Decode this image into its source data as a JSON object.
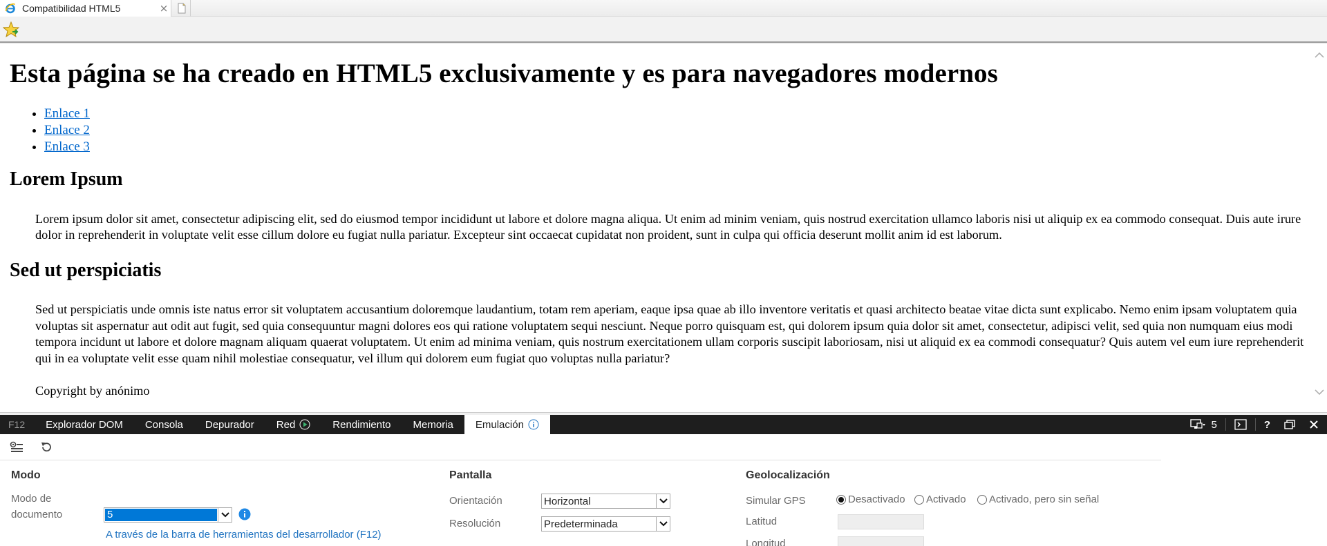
{
  "browser": {
    "tab_title": "Compatibilidad HTML5",
    "tab_close": "×"
  },
  "page": {
    "heading": "Esta página se ha creado en HTML5 exclusivamente y es para navegadores modernos",
    "links": [
      "Enlace 1",
      "Enlace 2",
      "Enlace 3"
    ],
    "section1_title": "Lorem Ipsum",
    "section1_text": "Lorem ipsum dolor sit amet, consectetur adipiscing elit, sed do eiusmod tempor incididunt ut labore et dolore magna aliqua. Ut enim ad minim veniam, quis nostrud exercitation ullamco laboris nisi ut aliquip ex ea commodo consequat. Duis aute irure dolor in reprehenderit in voluptate velit esse cillum dolore eu fugiat nulla pariatur. Excepteur sint occaecat cupidatat non proident, sunt in culpa qui officia deserunt mollit anim id est laborum.",
    "section2_title": "Sed ut perspiciatis",
    "section2_text": "Sed ut perspiciatis unde omnis iste natus error sit voluptatem accusantium doloremque laudantium, totam rem aperiam, eaque ipsa quae ab illo inventore veritatis et quasi architecto beatae vitae dicta sunt explicabo. Nemo enim ipsam voluptatem quia voluptas sit aspernatur aut odit aut fugit, sed quia consequuntur magni dolores eos qui ratione voluptatem sequi nesciunt. Neque porro quisquam est, qui dolorem ipsum quia dolor sit amet, consectetur, adipisci velit, sed quia non numquam eius modi tempora incidunt ut labore et dolore magnam aliquam quaerat voluptatem. Ut enim ad minima veniam, quis nostrum exercitationem ullam corporis suscipit laboriosam, nisi ut aliquid ex ea commodi consequatur? Quis autem vel eum iure reprehenderit qui in ea voluptate velit esse quam nihil molestiae consequatur, vel illum qui dolorem eum fugiat quo voluptas nulla pariatur?",
    "copyright": "Copyright by anónimo"
  },
  "devtools": {
    "f12_label": "F12",
    "tabs": [
      "Explorador DOM",
      "Consola",
      "Depurador",
      "Red",
      "Rendimiento",
      "Memoria",
      "Emulación"
    ],
    "active_tab": "Emulación",
    "target_count": "5",
    "help_label": "?",
    "colors": {
      "bar_bg": "#1e1e1e",
      "accent": "#1e72c0",
      "selection": "#0078d7",
      "play_green": "#3cb371"
    }
  },
  "emulation": {
    "mode": {
      "title": "Modo",
      "doc_mode_label_1": "Modo de",
      "doc_mode_label_2": "documento",
      "doc_mode_value": "5",
      "doc_mode_source": "A través de la barra de herramientas del desarrollador (F12)"
    },
    "screen": {
      "title": "Pantalla",
      "orientation_label": "Orientación",
      "orientation_value": "Horizontal",
      "resolution_label": "Resolución",
      "resolution_value": "Predeterminada"
    },
    "geo": {
      "title": "Geolocalización",
      "gps_label": "Simular GPS",
      "gps_options": [
        "Desactivado",
        "Activado",
        "Activado, pero sin señal"
      ],
      "gps_selected": "Desactivado",
      "latitude_label": "Latitud",
      "longitude_label": "Longitud"
    }
  }
}
